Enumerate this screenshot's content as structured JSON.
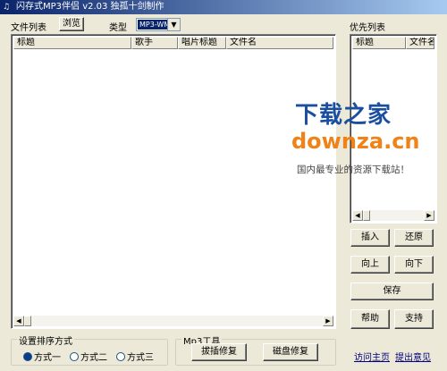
{
  "window": {
    "title": "闪存式MP3伴侣 v2.03 独孤十剑制作"
  },
  "file_list": {
    "label": "文件列表",
    "browse_button": "浏览",
    "type_label": "类型",
    "type_value": "MP3-WMA",
    "columns": [
      "标题",
      "歌手",
      "唱片标题",
      "文件名"
    ]
  },
  "priority_list": {
    "label": "优先列表",
    "columns": [
      "标题",
      "文件名"
    ]
  },
  "buttons": {
    "insert": "插入",
    "restore": "还原",
    "move_up": "向上",
    "move_down": "向下",
    "save": "保存",
    "help": "帮助",
    "support": "支持"
  },
  "sort_group": {
    "label": "设置排序方式",
    "options": [
      "方式一",
      "方式二",
      "方式三"
    ],
    "selected": 0
  },
  "tools_group": {
    "label": "Mp3工具",
    "plug_repair": "拔插修复",
    "disk_repair": "磁盘修复"
  },
  "links": {
    "home": "访问主页",
    "feedback": "提出意见"
  },
  "watermark": {
    "brand": "下载之家",
    "url": "downza.cn",
    "slogan": "国内最专业的资源下载站！"
  },
  "colors": {
    "titlebar_start": "#0a246a",
    "titlebar_end": "#a6caf0",
    "window_bg": "#ece9d8",
    "watermark_blue": "#1a4fa0",
    "watermark_orange": "#f08218"
  }
}
